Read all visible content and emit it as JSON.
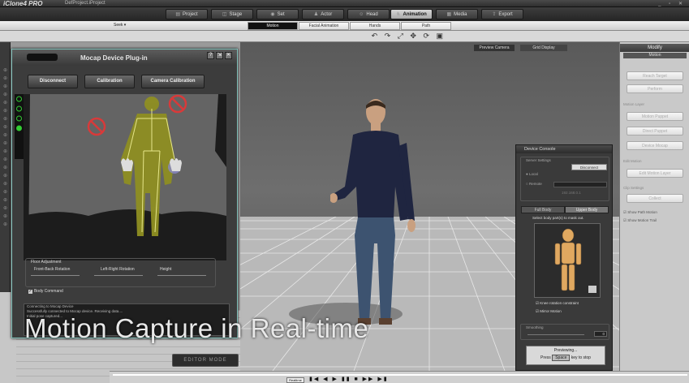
{
  "app": {
    "title": "iClone4 PRO",
    "project": "DefProject.iProject",
    "window_buttons": "_ ▫ ✕"
  },
  "main_tabs": [
    {
      "label": "Project",
      "active": false
    },
    {
      "label": "Stage",
      "active": false
    },
    {
      "label": "Set",
      "active": false
    },
    {
      "label": "Actor",
      "active": false
    },
    {
      "label": "Head",
      "active": false
    },
    {
      "label": "Animation",
      "active": true
    },
    {
      "label": "Media",
      "active": false
    },
    {
      "label": "Export",
      "active": false
    }
  ],
  "sub_tabs": [
    {
      "label": "Motion",
      "active": true
    },
    {
      "label": "Facial Animation",
      "active": false
    },
    {
      "label": "Hands",
      "active": false
    },
    {
      "label": "Path",
      "active": false
    }
  ],
  "sub_select": "Seek ▾",
  "toolbar_icons": "↶ ↷ ⤢ ✥ ⟳ ▣",
  "viewport": {
    "camera_tab": "Preview Camera",
    "second_tab": "Grid Display"
  },
  "mocap": {
    "title": "Mocap Device Plug-in",
    "buttons": {
      "help": "?",
      "restore": "⇲",
      "close": "✕"
    },
    "disconnect": "Disconnect",
    "calibration": "Calibration",
    "camera_calibration": "Camera Calibration",
    "floor_adjustment": "Floor Adjustment",
    "front_back": "Front-Back Rotation",
    "left_right": "Left-Right Rotation",
    "height": "Height",
    "body_command": "Body Command",
    "log": [
      "Connecting to Mocap Device",
      "Successfully connected to Mocap device. Receiving data....",
      "Initial pose captured..."
    ]
  },
  "caption": "Motion Capture in Real-time",
  "editor_mode": "EDITOR MODE",
  "console": {
    "title": "Device Console",
    "server_settings": "Server Settings",
    "disconnect": "Disconnect",
    "local": "Local",
    "remote": "Remote",
    "ip": "192.168.0.1",
    "full_body": "Full Body",
    "upper_body": "Upper Body",
    "select_parts": "Select body part(s) to mask out.",
    "knee_constraint": "Knee rotation constraint",
    "mirror_motion": "Mirror Motion",
    "smoothing": "Smoothing",
    "smoothing_value": "0",
    "previewing": "Previewing...",
    "press": "Press",
    "space_key": "Space",
    "key_to_stop": "key to stop"
  },
  "modify": {
    "title": "Modify",
    "dropdown": "Motion",
    "buttons": [
      "Reach Target",
      "Perform",
      "Motion Puppet",
      "Direct Puppet",
      "Device Mocap",
      "Edit Motion Layer",
      "Collect"
    ],
    "labels": [
      "Motion Layer",
      "Motion Puppet",
      "Edit Motion",
      "Clip Settings"
    ],
    "checks": [
      "Show Path Motion",
      "Show Motion Trail"
    ]
  },
  "timeline": {
    "realtime": "Realtime",
    "transport": "▮◀ ◀ ▶ ▮▮ ■ ▶▶ ▶▮"
  },
  "colors": {
    "accent_tab": "#d0d0d0",
    "body_yellow": "#9a9a2a",
    "stop_red": "#d83a3a",
    "mannequin": "#e0a860"
  }
}
